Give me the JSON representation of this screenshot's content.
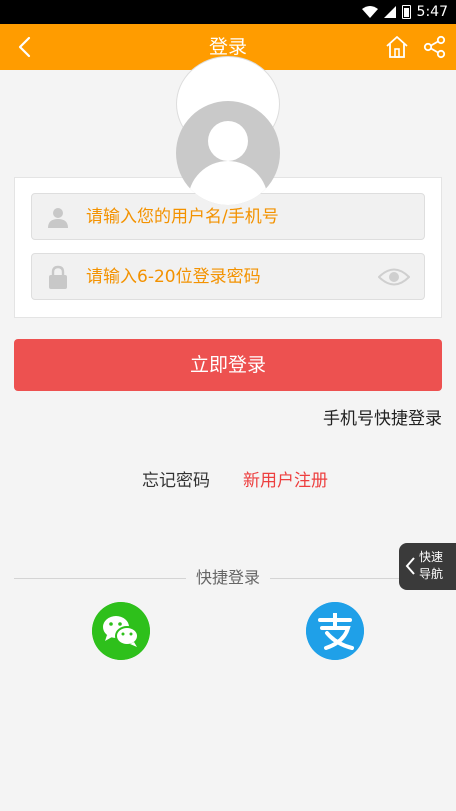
{
  "status_bar": {
    "time": "5:47"
  },
  "header": {
    "title": "登录",
    "back_icon": "back-arrow-icon",
    "home_icon": "home-icon",
    "share_icon": "share-icon"
  },
  "form": {
    "username_placeholder": "请输入您的用户名/手机号",
    "password_placeholder": "请输入6-20位登录密码"
  },
  "login_button": "立即登录",
  "quick_phone_login": "手机号快捷登录",
  "links": {
    "forgot": "忘记密码",
    "register": "新用户注册"
  },
  "quick_login": {
    "label": "快捷登录",
    "wechat_icon": "wechat-icon",
    "alipay_icon": "alipay-icon"
  },
  "quick_nav": {
    "line1": "快速",
    "line2": "导航"
  },
  "colors": {
    "header": "#ff9c00",
    "button": "#ed5150",
    "placeholder": "#f39200",
    "register": "#ed3f3f",
    "wechat": "#2ec01b",
    "alipay": "#1fa0e8"
  }
}
